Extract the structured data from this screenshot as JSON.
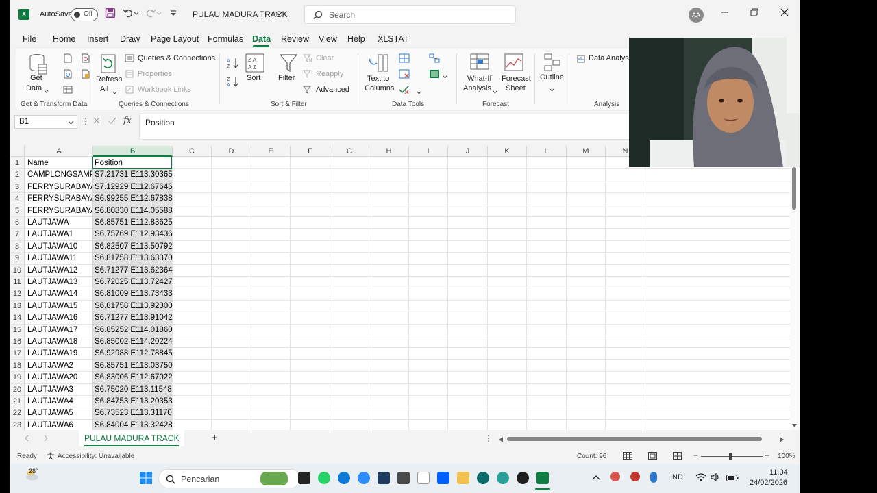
{
  "titlebar": {
    "autosave_label": "AutoSave",
    "autosave_state": "Off",
    "doc_title": "PULAU MADURA TRACK",
    "search_placeholder": "Search",
    "user_initials": "AA"
  },
  "tabs": [
    "File",
    "Home",
    "Insert",
    "Draw",
    "Page Layout",
    "Formulas",
    "Data",
    "Review",
    "View",
    "Help",
    "XLSTAT"
  ],
  "active_tab": "Data",
  "ribbon": {
    "get_data": [
      "Get",
      "Data"
    ],
    "queries_connections": "Queries & Connections",
    "properties": "Properties",
    "workbook_links": "Workbook Links",
    "refresh": [
      "Refresh",
      "All"
    ],
    "sort": "Sort",
    "filter": "Filter",
    "clear": "Clear",
    "reapply": "Reapply",
    "advanced": "Advanced",
    "text_to_columns": [
      "Text to",
      "Columns"
    ],
    "what_if": [
      "What-If",
      "Analysis"
    ],
    "forecast_sheet": [
      "Forecast",
      "Sheet"
    ],
    "outline": "Outline",
    "data_analysis": "Data Analysis",
    "groups": {
      "get_transform": "Get & Transform Data",
      "queries": "Queries & Connections",
      "sort_filter": "Sort & Filter",
      "data_tools": "Data Tools",
      "forecast": "Forecast",
      "analysis": "Analysis"
    }
  },
  "formula_bar": {
    "name_box": "B1",
    "fx": "fx",
    "value": "Position"
  },
  "columns": [
    "A",
    "B",
    "C",
    "D",
    "E",
    "F",
    "G",
    "H",
    "I",
    "J",
    "K",
    "L",
    "M",
    "N"
  ],
  "rows": [
    {
      "n": "1",
      "a": "Name",
      "b": "Position"
    },
    {
      "n": "2",
      "a": "CAMPLONGSAMP",
      "b": "S7.21731 E113.30365"
    },
    {
      "n": "3",
      "a": "FERRYSURABAYA-",
      "b": "S7.12929 E112.67646"
    },
    {
      "n": "4",
      "a": "FERRYSURABAYA-",
      "b": "S6.99255 E112.67838"
    },
    {
      "n": "5",
      "a": "FERRYSURABAYA-",
      "b": "S6.80830 E114.05588"
    },
    {
      "n": "6",
      "a": "LAUTJAWA",
      "b": "S6.85751 E112.83625"
    },
    {
      "n": "7",
      "a": "LAUTJAWA1",
      "b": "S6.75769 E112.93436"
    },
    {
      "n": "8",
      "a": "LAUTJAWA10",
      "b": "S6.82507 E113.50792"
    },
    {
      "n": "9",
      "a": "LAUTJAWA11",
      "b": "S6.81758 E113.63370"
    },
    {
      "n": "10",
      "a": "LAUTJAWA12",
      "b": "S6.71277 E113.62364"
    },
    {
      "n": "11",
      "a": "LAUTJAWA13",
      "b": "S6.72025 E113.72427"
    },
    {
      "n": "12",
      "a": "LAUTJAWA14",
      "b": "S6.81009 E113.73433"
    },
    {
      "n": "13",
      "a": "LAUTJAWA15",
      "b": "S6.81758 E113.92300"
    },
    {
      "n": "14",
      "a": "LAUTJAWA16",
      "b": "S6.71277 E113.91042"
    },
    {
      "n": "15",
      "a": "LAUTJAWA17",
      "b": "S6.85252 E114.01860"
    },
    {
      "n": "16",
      "a": "LAUTJAWA18",
      "b": "S6.85002 E114.20224"
    },
    {
      "n": "17",
      "a": "LAUTJAWA19",
      "b": "S6.92988 E112.78845"
    },
    {
      "n": "18",
      "a": "LAUTJAWA2",
      "b": "S6.85751 E113.03750"
    },
    {
      "n": "19",
      "a": "LAUTJAWA20",
      "b": "S6.83006 E112.67022"
    },
    {
      "n": "20",
      "a": "LAUTJAWA3",
      "b": "S6.75020 E113.11548"
    },
    {
      "n": "21",
      "a": "LAUTJAWA4",
      "b": "S6.84753 E113.20353"
    },
    {
      "n": "22",
      "a": "LAUTJAWA5",
      "b": "S6.73523 E113.31170"
    },
    {
      "n": "23",
      "a": "LAUTJAWA6",
      "b": "S6.84004 E113.32428"
    }
  ],
  "sheet_tab": "PULAU MADURA TRACK",
  "add_sheet": "+",
  "status": {
    "ready": "Ready",
    "accessibility": "Accessibility: Unavailable",
    "count": "Count: 96",
    "zoom": "100%"
  },
  "taskbar": {
    "weather": "28°",
    "search_text": "Pencarian",
    "lang": "IND",
    "time": "11.04",
    "date": "24/02/2026"
  }
}
